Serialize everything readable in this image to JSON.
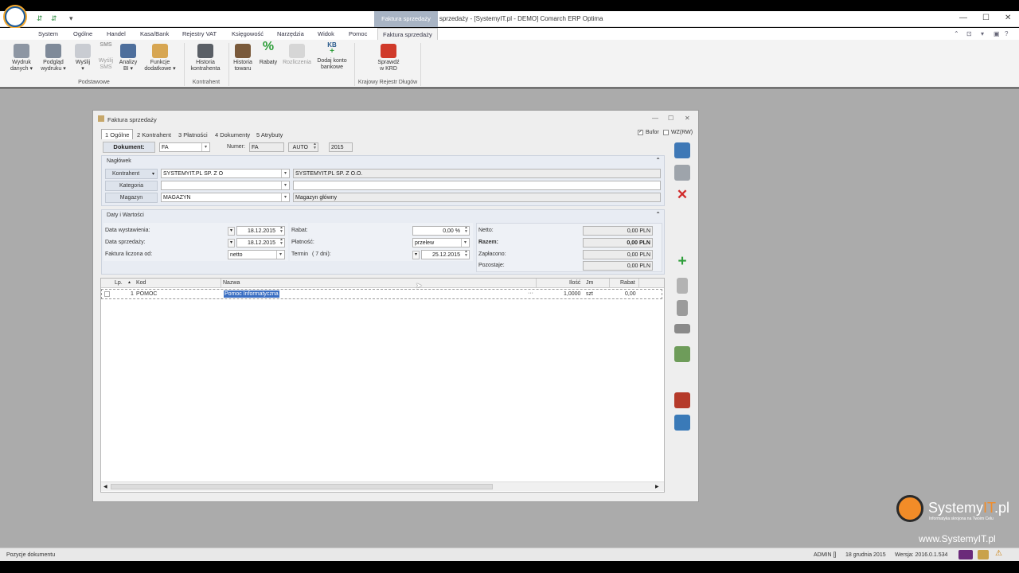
{
  "app": {
    "title": "Faktura sprzedaży - [SystemyIT.pl - DEMO] Comarch ERP Optima",
    "context_tab": "Faktura sprzedaży"
  },
  "menu": [
    "System",
    "Ogólne",
    "Handel",
    "Kasa/Bank",
    "Rejestry VAT",
    "Księgowość",
    "Narzędzia",
    "Widok",
    "Pomoc",
    "Faktura sprzedaży"
  ],
  "ribbon": {
    "buttons": [
      "Wydruk\ndanych",
      "Podgląd\nwydruku",
      "Wyślij",
      "Wyślij\nSMS",
      "Analizy\nBI",
      "Funkcje\ndodatkowe",
      "Historia\nkontrahenta",
      "Historia\ntowaru",
      "Rabaty",
      "Rozliczenia",
      "Dodaj konto\nbankowe",
      "Sprawdź\nw KRD"
    ],
    "groups": [
      "Podstawowe",
      "Kontrahent",
      "Krajowy Rejestr Długów"
    ],
    "sms_badge": "SMS",
    "kb_badge": "KB"
  },
  "dialog": {
    "title": "Faktura sprzedaży",
    "tabs": [
      "1 Ogólne",
      "2 Kontrahent",
      "3 Płatności",
      "4 Dokumenty",
      "5 Atrybuty"
    ],
    "bufor_label": "Bufor",
    "wzrw_label": "WZ(RW)",
    "document": {
      "label": "Dokument:",
      "value": "FA",
      "number_label": "Numer:",
      "number_prefix": "FA",
      "auto": "AUTO",
      "year": "2015"
    },
    "header": {
      "title": "Nagłówek",
      "kontrahent_label": "Kontrahent",
      "kontrahent_code": "SYSTEMYIT.PL SP. Z O",
      "kontrahent_name": "SYSTEMYIT.PL SP. Z O.O.",
      "kategoria_label": "Kategoria",
      "magazyn_label": "Magazyn",
      "magazyn_code": "MAGAZYN",
      "magazyn_name": "Magazyn główny"
    },
    "dates": {
      "title": "Daty i Wartości",
      "issue_label": "Data wystawienia:",
      "issue": "18.12.2015",
      "sale_label": "Data sprzedaży:",
      "sale": "18.12.2015",
      "calc_label": "Faktura liczona od:",
      "calc": "netto",
      "rabat_label": "Rabat:",
      "rabat": "0,00 %",
      "platnosc_label": "Płatność:",
      "platnosc": "przelew",
      "termin_label": "Termin",
      "termin_days": "(    7 dni):",
      "termin": "25.12.2015"
    },
    "totals": {
      "netto_label": "Netto:",
      "netto": "0,00 PLN",
      "razem_label": "Razem:",
      "razem": "0,00 PLN",
      "zaplacono_label": "Zapłacono:",
      "zaplacono": "0,00 PLN",
      "pozostaje_label": "Pozostaje:",
      "pozostaje": "0,00 PLN"
    },
    "grid": {
      "columns": [
        "Lp.",
        "Kod",
        "Nazwa",
        "Ilość",
        "Jm",
        "Rabat"
      ],
      "rows": [
        {
          "lp": "1",
          "kod": "POMOC",
          "nazwa": "Pomoc Informatyczna",
          "ilosc": "1,0000",
          "jm": "szt",
          "rabat": "0,00"
        }
      ]
    }
  },
  "status": {
    "left": "Pozycje dokumentu",
    "user": "ADMIN []",
    "date": "18 grudnia 2015",
    "version": "Wersja: 2016.0.1.534"
  },
  "watermark": {
    "brand_a": "Systemy",
    "brand_b": "IT",
    "brand_c": ".pl",
    "tagline": "Informatyka skrojona na Twoim Celu",
    "url": "www.SystemyIT.pl"
  },
  "colors": {
    "accent": "#2b6cb0",
    "workspace": "#ababab",
    "brand_orange": "#f28c28"
  }
}
